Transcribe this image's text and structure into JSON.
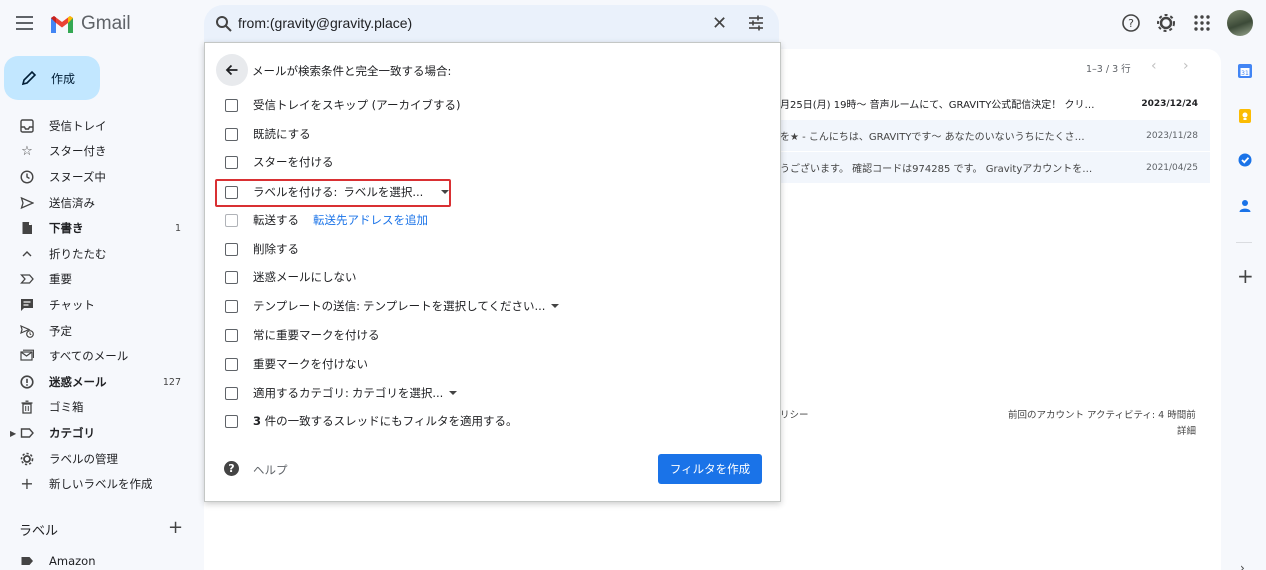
{
  "app": {
    "name": "Gmail"
  },
  "search": {
    "query": "from:(gravity@gravity.place)"
  },
  "sidebar": {
    "compose_label": "作成",
    "items": [
      {
        "label": "受信トレイ",
        "count": "",
        "bold": false
      },
      {
        "label": "スター付き",
        "count": "",
        "bold": false
      },
      {
        "label": "スヌーズ中",
        "count": "",
        "bold": false
      },
      {
        "label": "送信済み",
        "count": "",
        "bold": false
      },
      {
        "label": "下書き",
        "count": "1",
        "bold": true
      },
      {
        "label": "折りたたむ",
        "count": "",
        "bold": false
      },
      {
        "label": "重要",
        "count": "",
        "bold": false
      },
      {
        "label": "チャット",
        "count": "",
        "bold": false
      },
      {
        "label": "予定",
        "count": "",
        "bold": false
      },
      {
        "label": "すべてのメール",
        "count": "",
        "bold": false
      },
      {
        "label": "迷惑メール",
        "count": "127",
        "bold": true
      },
      {
        "label": "ゴミ箱",
        "count": "",
        "bold": false
      },
      {
        "label": "カテゴリ",
        "count": "",
        "bold": true
      },
      {
        "label": "ラベルの管理",
        "count": "",
        "bold": false
      },
      {
        "label": "新しいラベルを作成",
        "count": "",
        "bold": false
      }
    ],
    "labels_header": "ラベル",
    "labels": [
      {
        "label": "Amazon"
      }
    ]
  },
  "mail_list": {
    "pager": "1–3 / 3 行",
    "rows": [
      {
        "snippet": "月25日(月) 19時〜 音声ルームにて、GRAVITY公式配信決定！ クリ…",
        "date": "2023/12/24",
        "unread": true
      },
      {
        "snippet": "を★ - こんにちは、GRAVITYです〜 あなたのいないうちにたくさ…",
        "date": "2023/11/28",
        "unread": false
      },
      {
        "snippet": "うございます。 確認コードは974285 です。 Gravityアカウントを…",
        "date": "2021/04/25",
        "unread": false
      }
    ],
    "footer_left": "リシー",
    "footer_activity": "前回のアカウント アクティビティ: 4 時間前",
    "footer_detail": "詳細"
  },
  "filter_dialog": {
    "title": "メールが検索条件と完全一致する場合:",
    "options": [
      {
        "label": "受信トレイをスキップ (アーカイブする)"
      },
      {
        "label": "既読にする"
      },
      {
        "label": "スターを付ける"
      },
      {
        "label": "ラベルを付ける:",
        "select": "ラベルを選択..."
      },
      {
        "label": "転送する",
        "link": "転送先アドレスを追加"
      },
      {
        "label": "削除する"
      },
      {
        "label": "迷惑メールにしない"
      },
      {
        "label": "テンプレートの送信:",
        "select": "テンプレートを選択してください..."
      },
      {
        "label": "常に重要マークを付ける"
      },
      {
        "label": "重要マークを付けない"
      },
      {
        "label": "適用するカテゴリ:",
        "select": "カテゴリを選択..."
      },
      {
        "label_bold": "3",
        "label": " 件の一致するスレッドにもフィルタを適用する。"
      }
    ],
    "help_label": "ヘルプ",
    "create_button": "フィルタを作成"
  },
  "colors": {
    "accent": "#1a73e8",
    "compose_bg": "#c2e7ff",
    "highlight_box": "#d93033",
    "search_bg": "#eaf1fb"
  }
}
